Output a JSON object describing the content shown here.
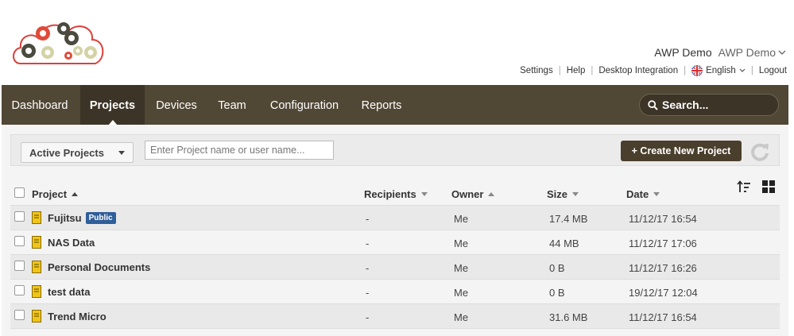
{
  "account": {
    "name": "AWP Demo",
    "dropdown_name": "AWP Demo"
  },
  "top_links": {
    "settings": "Settings",
    "help": "Help",
    "desktop_integration": "Desktop Integration",
    "language": "English",
    "logout": "Logout"
  },
  "nav": {
    "items": [
      {
        "label": "Dashboard"
      },
      {
        "label": "Projects"
      },
      {
        "label": "Devices"
      },
      {
        "label": "Team"
      },
      {
        "label": "Configuration"
      },
      {
        "label": "Reports"
      }
    ],
    "search_label": "Search..."
  },
  "filter": {
    "status_selected": "Active Projects",
    "search_placeholder": "Enter Project name or user name...",
    "create_label": "+ Create New Project"
  },
  "table": {
    "columns": {
      "project": "Project",
      "recipients": "Recipients",
      "owner": "Owner",
      "size": "Size",
      "date": "Date"
    },
    "rows": [
      {
        "name": "Fujitsu",
        "badge": "Public",
        "recipients": "-",
        "owner": "Me",
        "size": "17.4 MB",
        "date": "11/12/17 16:54"
      },
      {
        "name": "NAS Data",
        "badge": "",
        "recipients": "-",
        "owner": "Me",
        "size": "44 MB",
        "date": "11/12/17 17:06"
      },
      {
        "name": "Personal Documents",
        "badge": "",
        "recipients": "-",
        "owner": "Me",
        "size": "0 B",
        "date": "11/12/17 16:26"
      },
      {
        "name": "test data",
        "badge": "",
        "recipients": "-",
        "owner": "Me",
        "size": "0 B",
        "date": "19/12/17 12:04"
      },
      {
        "name": "Trend Micro",
        "badge": "",
        "recipients": "-",
        "owner": "Me",
        "size": "31.6 MB",
        "date": "11/12/17 16:54"
      }
    ]
  },
  "colors": {
    "nav_bg": "#514735",
    "nav_active": "#3c3426",
    "badge": "#2f5f9a",
    "create_button": "#4a3f2c",
    "file_icon": "#f0c419"
  },
  "icons": {
    "logo": "gears-cloud-logo",
    "search": "search-icon",
    "refresh": "refresh-icon",
    "sort": "sort-icon",
    "grid": "grid-view-icon",
    "file": "file-icon",
    "flag": "uk-flag-icon"
  }
}
